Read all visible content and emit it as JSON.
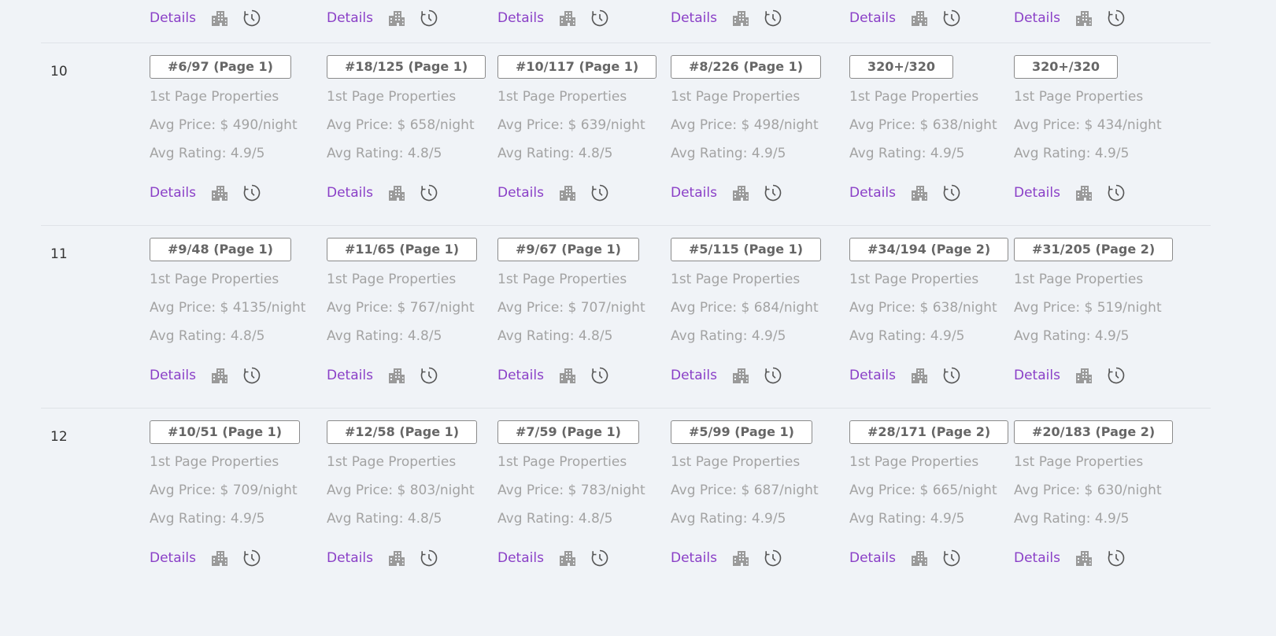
{
  "details_label": "Details",
  "icons": {
    "building": "building-icon",
    "history": "history-icon"
  },
  "colors": {
    "link": "#8a3fc7",
    "muted": "#a3a3a3",
    "rank_border": "#8a8a8a"
  },
  "rows": [
    {
      "label": "10",
      "cells": [
        {
          "rank": "#6/97 (Page 1)",
          "props": "1st Page Properties",
          "price": "Avg Price: $ 490/night",
          "rating": "Avg Rating: 4.9/5"
        },
        {
          "rank": "#18/125 (Page 1)",
          "props": "1st Page Properties",
          "price": "Avg Price: $ 658/night",
          "rating": "Avg Rating: 4.8/5"
        },
        {
          "rank": "#10/117 (Page 1)",
          "props": "1st Page Properties",
          "price": "Avg Price: $ 639/night",
          "rating": "Avg Rating: 4.8/5"
        },
        {
          "rank": "#8/226 (Page 1)",
          "props": "1st Page Properties",
          "price": "Avg Price: $ 498/night",
          "rating": "Avg Rating: 4.9/5"
        },
        {
          "rank": "320+/320",
          "props": "1st Page Properties",
          "price": "Avg Price: $ 638/night",
          "rating": "Avg Rating: 4.9/5"
        },
        {
          "rank": "320+/320",
          "props": "1st Page Properties",
          "price": "Avg Price: $ 434/night",
          "rating": "Avg Rating: 4.9/5"
        }
      ]
    },
    {
      "label": "11",
      "cells": [
        {
          "rank": "#9/48 (Page 1)",
          "props": "1st Page Properties",
          "price": "Avg Price: $ 4135/night",
          "rating": "Avg Rating: 4.8/5"
        },
        {
          "rank": "#11/65 (Page 1)",
          "props": "1st Page Properties",
          "price": "Avg Price: $ 767/night",
          "rating": "Avg Rating: 4.8/5"
        },
        {
          "rank": "#9/67 (Page 1)",
          "props": "1st Page Properties",
          "price": "Avg Price: $ 707/night",
          "rating": "Avg Rating: 4.8/5"
        },
        {
          "rank": "#5/115 (Page 1)",
          "props": "1st Page Properties",
          "price": "Avg Price: $ 684/night",
          "rating": "Avg Rating: 4.9/5"
        },
        {
          "rank": "#34/194 (Page 2)",
          "props": "1st Page Properties",
          "price": "Avg Price: $ 638/night",
          "rating": "Avg Rating: 4.9/5"
        },
        {
          "rank": "#31/205 (Page 2)",
          "props": "1st Page Properties",
          "price": "Avg Price: $ 519/night",
          "rating": "Avg Rating: 4.9/5"
        }
      ]
    },
    {
      "label": "12",
      "cells": [
        {
          "rank": "#10/51 (Page 1)",
          "props": "1st Page Properties",
          "price": "Avg Price: $ 709/night",
          "rating": "Avg Rating: 4.9/5"
        },
        {
          "rank": "#12/58 (Page 1)",
          "props": "1st Page Properties",
          "price": "Avg Price: $ 803/night",
          "rating": "Avg Rating: 4.8/5"
        },
        {
          "rank": "#7/59 (Page 1)",
          "props": "1st Page Properties",
          "price": "Avg Price: $ 783/night",
          "rating": "Avg Rating: 4.8/5"
        },
        {
          "rank": "#5/99 (Page 1)",
          "props": "1st Page Properties",
          "price": "Avg Price: $ 687/night",
          "rating": "Avg Rating: 4.9/5"
        },
        {
          "rank": "#28/171 (Page 2)",
          "props": "1st Page Properties",
          "price": "Avg Price: $ 665/night",
          "rating": "Avg Rating: 4.9/5"
        },
        {
          "rank": "#20/183 (Page 2)",
          "props": "1st Page Properties",
          "price": "Avg Price: $ 630/night",
          "rating": "Avg Rating: 4.9/5"
        }
      ]
    }
  ]
}
